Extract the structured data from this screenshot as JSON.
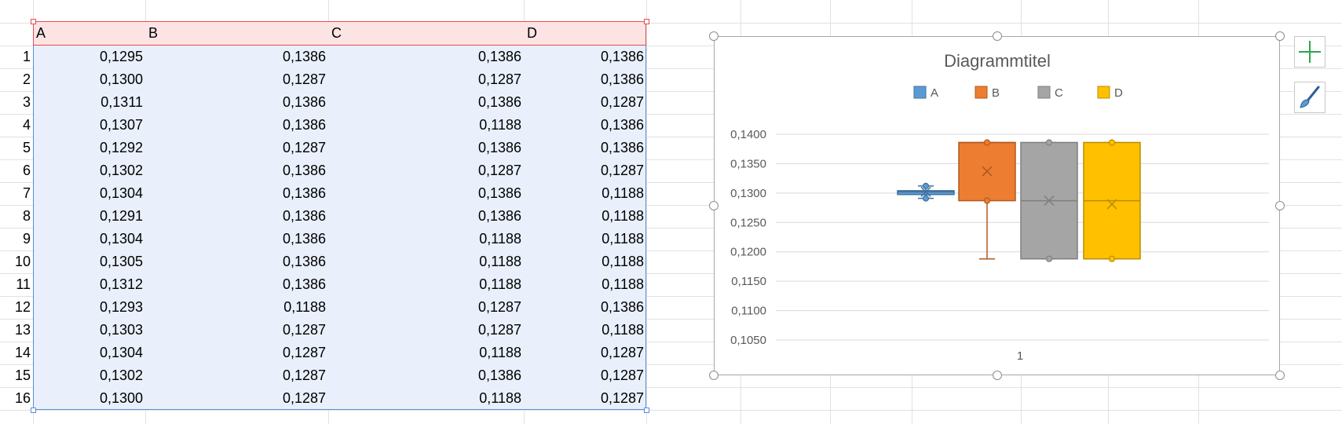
{
  "sheet": {
    "columns": [
      "A",
      "B",
      "C",
      "D"
    ],
    "rows": [
      {
        "n": "1",
        "a": "0,1295",
        "b": "0,1386",
        "c": "0,1386",
        "d": "0,1386"
      },
      {
        "n": "2",
        "a": "0,1300",
        "b": "0,1287",
        "c": "0,1287",
        "d": "0,1386"
      },
      {
        "n": "3",
        "a": "0,1311",
        "b": "0,1386",
        "c": "0,1386",
        "d": "0,1287"
      },
      {
        "n": "4",
        "a": "0,1307",
        "b": "0,1386",
        "c": "0,1188",
        "d": "0,1386"
      },
      {
        "n": "5",
        "a": "0,1292",
        "b": "0,1287",
        "c": "0,1386",
        "d": "0,1386"
      },
      {
        "n": "6",
        "a": "0,1302",
        "b": "0,1386",
        "c": "0,1287",
        "d": "0,1287"
      },
      {
        "n": "7",
        "a": "0,1304",
        "b": "0,1386",
        "c": "0,1386",
        "d": "0,1188"
      },
      {
        "n": "8",
        "a": "0,1291",
        "b": "0,1386",
        "c": "0,1386",
        "d": "0,1188"
      },
      {
        "n": "9",
        "a": "0,1304",
        "b": "0,1386",
        "c": "0,1188",
        "d": "0,1188"
      },
      {
        "n": "10",
        "a": "0,1305",
        "b": "0,1386",
        "c": "0,1188",
        "d": "0,1188"
      },
      {
        "n": "11",
        "a": "0,1312",
        "b": "0,1386",
        "c": "0,1188",
        "d": "0,1188"
      },
      {
        "n": "12",
        "a": "0,1293",
        "b": "0,1188",
        "c": "0,1287",
        "d": "0,1386"
      },
      {
        "n": "13",
        "a": "0,1303",
        "b": "0,1287",
        "c": "0,1287",
        "d": "0,1188"
      },
      {
        "n": "14",
        "a": "0,1304",
        "b": "0,1287",
        "c": "0,1188",
        "d": "0,1287"
      },
      {
        "n": "15",
        "a": "0,1302",
        "b": "0,1287",
        "c": "0,1386",
        "d": "0,1287"
      },
      {
        "n": "16",
        "a": "0,1300",
        "b": "0,1287",
        "c": "0,1188",
        "d": "0,1287"
      }
    ]
  },
  "chart_data": {
    "type": "box",
    "title": "Diagrammtitel",
    "xlabel": "",
    "ylabel": "",
    "categories": [
      "1"
    ],
    "ylim": [
      0.105,
      0.14
    ],
    "yticks": [
      "0,1050",
      "0,1100",
      "0,1150",
      "0,1200",
      "0,1250",
      "0,1300",
      "0,1350",
      "0,1400"
    ],
    "legend_position": "top",
    "grid": true,
    "series": [
      {
        "name": "A",
        "color": "#5b9bd5",
        "stroke": "#41719c",
        "min": 0.1291,
        "q1": 0.12975,
        "median": 0.1302,
        "q3": 0.1304,
        "max": 0.1312,
        "mean": 0.1302,
        "points": [
          0.1291,
          0.1312
        ]
      },
      {
        "name": "B",
        "color": "#ed7d31",
        "stroke": "#ae5a21",
        "min": 0.1188,
        "q1": 0.1287,
        "median": 0.1386,
        "q3": 0.1386,
        "max": 0.1386,
        "mean": 0.1337,
        "points": [
          0.1287,
          0.1386
        ]
      },
      {
        "name": "C",
        "color": "#a5a5a5",
        "stroke": "#7f7f7f",
        "min": 0.1188,
        "q1": 0.1188,
        "median": 0.1287,
        "q3": 0.1386,
        "max": 0.1386,
        "mean": 0.1287,
        "points": [
          0.1188,
          0.1386
        ]
      },
      {
        "name": "D",
        "color": "#ffc000",
        "stroke": "#bc8c00",
        "min": 0.1188,
        "q1": 0.1188,
        "median": 0.1287,
        "q3": 0.1386,
        "max": 0.1386,
        "mean": 0.1281,
        "points": [
          0.1188,
          0.1386
        ]
      }
    ]
  },
  "side_buttons": [
    {
      "icon": "plus-icon"
    },
    {
      "icon": "brush-icon"
    }
  ]
}
